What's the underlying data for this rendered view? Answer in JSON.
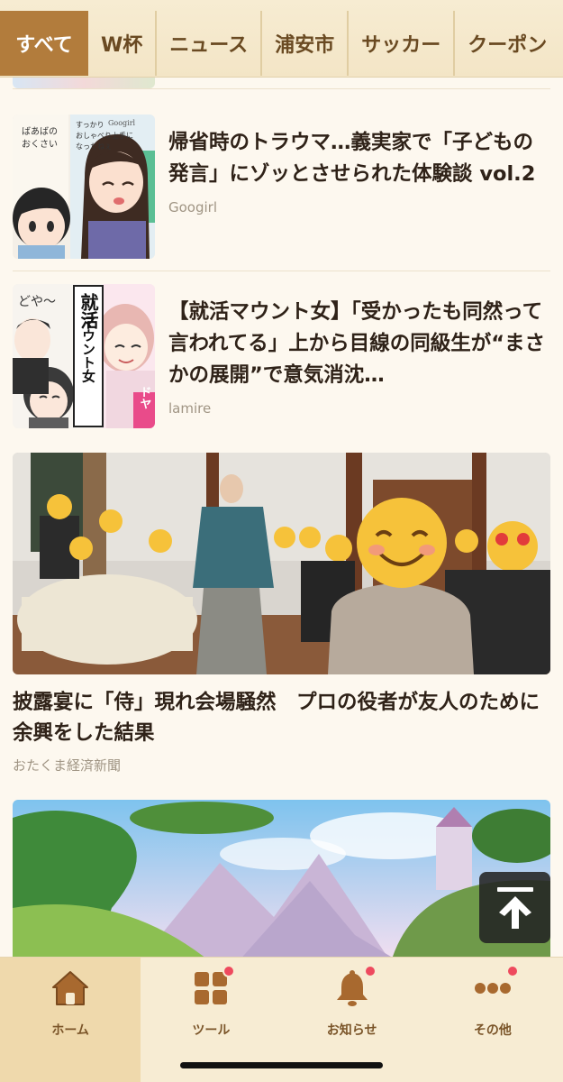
{
  "tabs": [
    {
      "label": "すべて",
      "active": true
    },
    {
      "label": "W杯",
      "active": false
    },
    {
      "label": "ニュース",
      "active": false
    },
    {
      "label": "浦安市",
      "active": false
    },
    {
      "label": "サッカー",
      "active": false
    },
    {
      "label": "クーポン",
      "active": false
    }
  ],
  "articles": [
    {
      "title": "帰省時のトラウマ…義実家で「子どもの発言」にゾッとさせられた体験談 vol.2",
      "source": "Googirl",
      "thumb_texts": [
        "ばあばの",
        "おくさい",
        "すっかり",
        "おしゃべり上手に",
        "なったねぇ",
        "Googirl"
      ]
    },
    {
      "title": "【就活マウント女】「受かったも同然って言われてる」上から目線の同級生が“まさかの展開”で意気消沈…",
      "source": "lamire",
      "thumb_texts": [
        "就活",
        "マウント女",
        "どや〜",
        "ドヤ"
      ]
    }
  ],
  "featured": {
    "title": "披露宴に「侍」現れ会場騒然　プロの役者が友人のために余興をした結果",
    "source": "おたくま経済新聞"
  },
  "bottom_nav": [
    {
      "label": "ホーム",
      "icon": "home-icon",
      "active": true,
      "badge": false
    },
    {
      "label": "ツール",
      "icon": "grid-icon",
      "active": false,
      "badge": true
    },
    {
      "label": "お知らせ",
      "icon": "bell-icon",
      "active": false,
      "badge": true
    },
    {
      "label": "その他",
      "icon": "more-icon",
      "active": false,
      "badge": true
    }
  ],
  "colors": {
    "accent": "#b27c3c",
    "badge": "#ee4a5e",
    "nav_bg": "#f7ecd3"
  }
}
